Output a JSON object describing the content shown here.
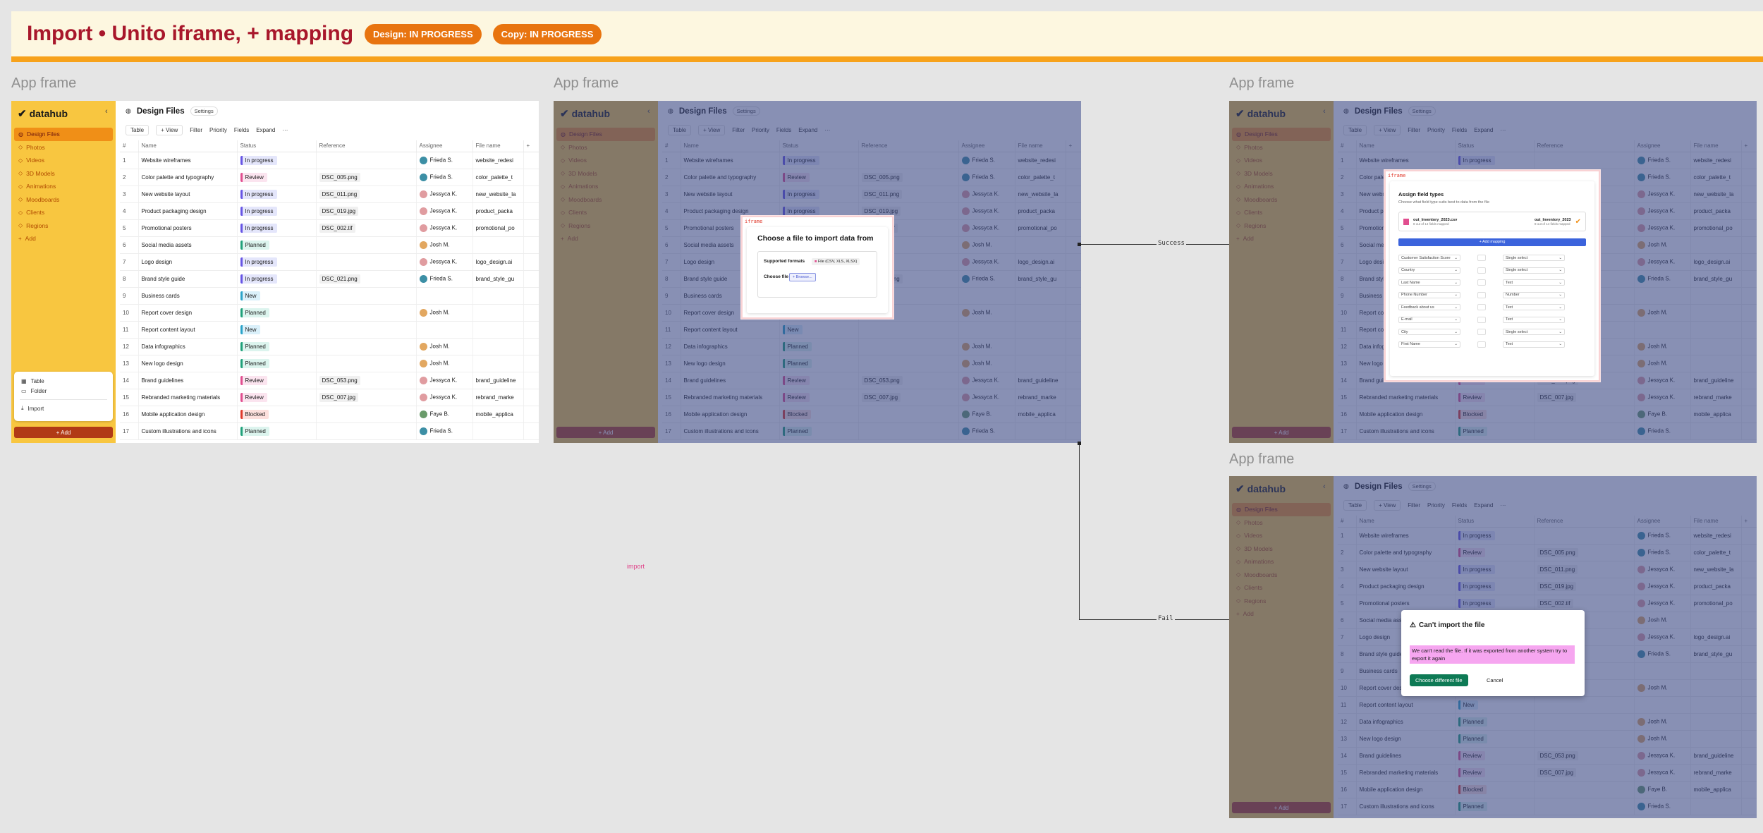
{
  "header": {
    "title": "Import • Unito iframe, + mapping",
    "badges": [
      "Design: IN PROGRESS",
      "Copy: IN PROGRESS"
    ]
  },
  "frame_label": "App frame",
  "app": {
    "brand": "datahub",
    "title": "Design Files",
    "settings": "Settings",
    "nav": [
      "Design Files",
      "Photos",
      "Videos",
      "3D Models",
      "Animations",
      "Moodboards",
      "Clients",
      "Regions",
      "Add"
    ],
    "toolbar": [
      "Table",
      "+ View",
      "Filter",
      "Priority",
      "Fields",
      "Expand",
      "···"
    ],
    "columns": [
      "#",
      "Name",
      "Status",
      "Reference",
      "Assignee",
      "File name"
    ],
    "rows": [
      [
        "1",
        "Website wireframes",
        "In progress",
        "",
        "Frieda S.",
        "website_redesi"
      ],
      [
        "2",
        "Color palette and typography",
        "Review",
        "DSC_005.png",
        "Frieda S.",
        "color_palette_t"
      ],
      [
        "3",
        "New website layout",
        "In progress",
        "DSC_011.png",
        "Jessyca K.",
        "new_website_la"
      ],
      [
        "4",
        "Product packaging design",
        "In progress",
        "DSC_019.jpg",
        "Jessyca K.",
        "product_packa"
      ],
      [
        "5",
        "Promotional posters",
        "In progress",
        "DSC_002.tif",
        "Jessyca K.",
        "promotional_po"
      ],
      [
        "6",
        "Social media assets",
        "Planned",
        "",
        "Josh M.",
        ""
      ],
      [
        "7",
        "Logo design",
        "In progress",
        "",
        "Jessyca K.",
        "logo_design.ai"
      ],
      [
        "8",
        "Brand style guide",
        "In progress",
        "DSC_021.png",
        "Frieda S.",
        "brand_style_gu"
      ],
      [
        "9",
        "Business cards",
        "New",
        "",
        "",
        ""
      ],
      [
        "10",
        "Report cover design",
        "Planned",
        "",
        "Josh M.",
        ""
      ],
      [
        "11",
        "Report content layout",
        "New",
        "",
        "",
        ""
      ],
      [
        "12",
        "Data infographics",
        "Planned",
        "",
        "Josh M.",
        ""
      ],
      [
        "13",
        "New logo design",
        "Planned",
        "",
        "Josh M.",
        ""
      ],
      [
        "14",
        "Brand guidelines",
        "Review",
        "DSC_053.png",
        "Jessyca K.",
        "brand_guideline"
      ],
      [
        "15",
        "Rebranded marketing materials",
        "Review",
        "DSC_007.jpg",
        "Jessyca K.",
        "rebrand_marke"
      ],
      [
        "16",
        "Mobile application design",
        "Blocked",
        "",
        "Faye B.",
        "mobile_applica"
      ],
      [
        "17",
        "Custom illustrations and icons",
        "Planned",
        "",
        "Frieda S.",
        ""
      ]
    ],
    "popup": [
      "Table",
      "Folder",
      "Import"
    ],
    "add_button": "+ Add"
  },
  "import_dialog": {
    "tag": "iframe",
    "title": "Choose a file to import data from",
    "formats_label": "Supported formats",
    "formats": "File (CSV, XLS, XLSX)",
    "choose_label": "Choose file",
    "browse": "+ Browse..."
  },
  "mapping_dialog": {
    "tag": "iframe",
    "title": "Assign field types",
    "subtitle": "Choose what field type suits best to data from the file",
    "file_left": "out_Inventory_2023.csv",
    "file_left_sub": "8 out of 14 fields mapped",
    "file_right": "out_Inventory_2023",
    "file_right_sub": "8 out of 14 fields mapped",
    "add_mapping": "+ Add mapping",
    "rows": [
      [
        "Customer Satisfaction Score",
        "Single select"
      ],
      [
        "Country",
        "Single select"
      ],
      [
        "Last Name",
        "Text"
      ],
      [
        "Phone Number",
        "Number"
      ],
      [
        "Feedback about us",
        "Text"
      ],
      [
        "E-mail",
        "Text"
      ],
      [
        "City",
        "Single select"
      ],
      [
        "First Name",
        "Text"
      ]
    ]
  },
  "error_dialog": {
    "title": "Can't import the file",
    "message": "We can't read the file. If it was exported from another system try to export it again",
    "primary": "Choose different file",
    "cancel": "Cancel"
  },
  "connectors": {
    "success": "Success",
    "fail": "Fail"
  },
  "annotation": "import",
  "colors": {
    "accent": "#f7a21b",
    "title": "#a8172b",
    "sidebar": "#f8c640",
    "primary": "#0e7a55"
  }
}
